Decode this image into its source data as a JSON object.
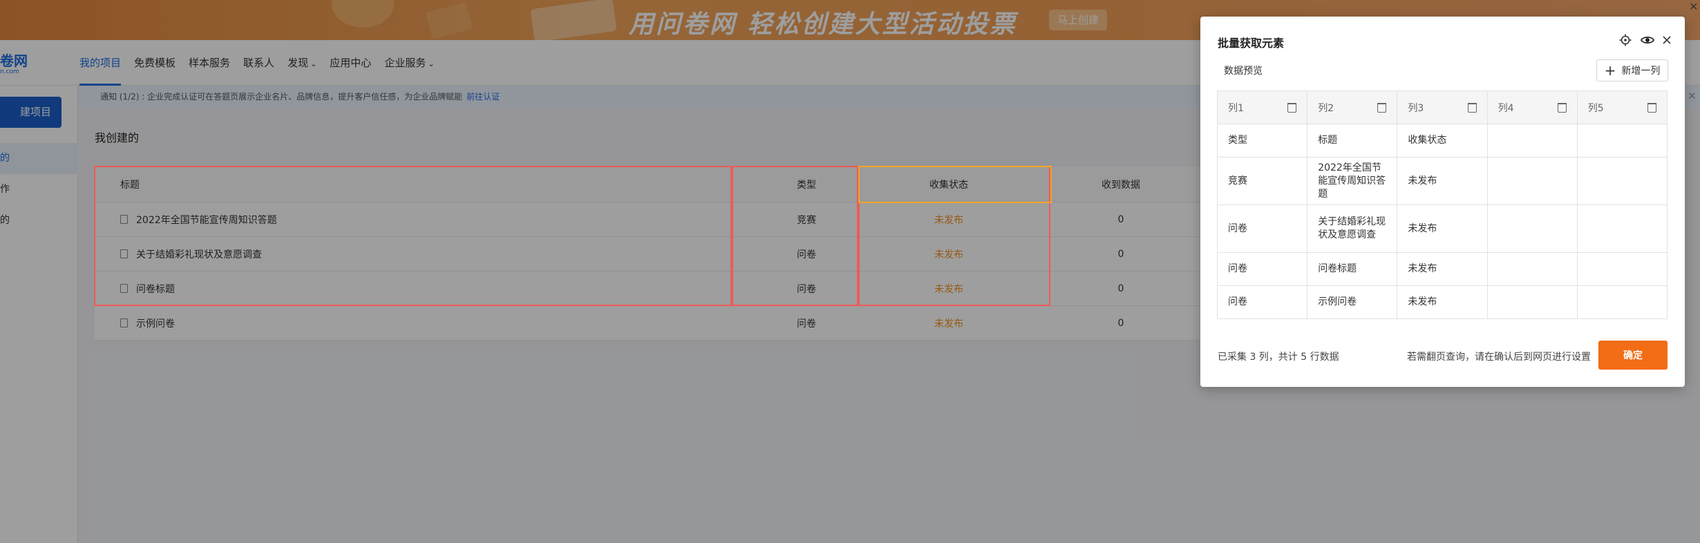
{
  "banner": {
    "text": "用问卷网  轻松创建大型活动投票",
    "button": "马上创建",
    "close_icon": "close-icon"
  },
  "nav": {
    "logo_text": "卷网",
    "logo_sub": "n.com",
    "items": [
      {
        "label": "我的项目"
      },
      {
        "label": "免费模板"
      },
      {
        "label": "样本服务"
      },
      {
        "label": "联系人"
      },
      {
        "label": "发现"
      },
      {
        "label": "应用中心"
      },
      {
        "label": "企业服务"
      }
    ]
  },
  "sidebar": {
    "new_button": "建项目",
    "items": [
      {
        "label": "的"
      },
      {
        "label": "作"
      },
      {
        "label": "的"
      }
    ]
  },
  "notice": {
    "text": "通知   (1/2) : 企业完成认证可在答题页展示企业名片、品牌信息，提升客户信任感，为企业品牌赋能",
    "link": "前往认证"
  },
  "main": {
    "section_title": "我创建的",
    "columns": [
      "标题",
      "类型",
      "收集状态",
      "收到数据"
    ],
    "rows": [
      {
        "title": "2022年全国节能宣传周知识答题",
        "type": "竞赛",
        "status": "未发布",
        "count": "0"
      },
      {
        "title": "关于结婚彩礼现状及意愿调查",
        "type": "问卷",
        "status": "未发布",
        "count": "0"
      },
      {
        "title": "问卷标题",
        "type": "问卷",
        "status": "未发布",
        "count": "0"
      },
      {
        "title": "示例问卷",
        "type": "问卷",
        "status": "未发布",
        "count": "0"
      }
    ]
  },
  "panel": {
    "title": "批量获取元素",
    "subtitle": "数据预览",
    "add_column": "新增一列",
    "columns": [
      "列1",
      "列2",
      "列3",
      "列4",
      "列5"
    ],
    "rows": [
      [
        "类型",
        "标题",
        "收集状态",
        "",
        ""
      ],
      [
        "竞赛",
        "2022年全国节能宣传周知识答题",
        "未发布",
        "",
        ""
      ],
      [
        "问卷",
        "关于结婚彩礼现状及意愿调查",
        "未发布",
        "",
        ""
      ],
      [
        "问卷",
        "问卷标题",
        "未发布",
        "",
        ""
      ],
      [
        "问卷",
        "示例问卷",
        "未发布",
        "",
        ""
      ]
    ],
    "footer_left": "已采集 3 列，共计 5 行数据",
    "footer_right": "若需翻页查询，请在确认后到网页进行设置",
    "confirm": "确定",
    "icons": [
      "target-icon",
      "eye-icon",
      "close-icon"
    ]
  },
  "colors": {
    "accent": "#1c6ce0",
    "status": "#f3901e",
    "confirm": "#f26d16",
    "highlight": "#ef5a5a"
  }
}
